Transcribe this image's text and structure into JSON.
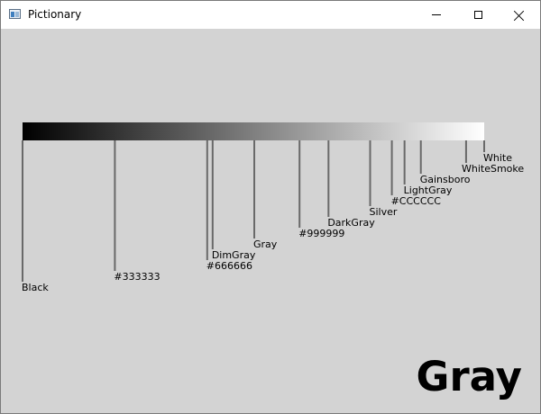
{
  "window": {
    "title": "Pictionary",
    "minimize_glyph": "—",
    "maximize_glyph": "☐",
    "close_glyph": "✕"
  },
  "gradient": {
    "start_color": "#000000",
    "end_color": "#FFFFFF"
  },
  "markers": [
    {
      "label": "Black",
      "value": 0
    },
    {
      "label": "#333333",
      "value": 51
    },
    {
      "label": "#666666",
      "value": 102
    },
    {
      "label": "DimGray",
      "value": 105
    },
    {
      "label": "Gray",
      "value": 128
    },
    {
      "label": "#999999",
      "value": 153
    },
    {
      "label": "DarkGray",
      "value": 169
    },
    {
      "label": "Silver",
      "value": 192
    },
    {
      "label": "#CCCCCC",
      "value": 204
    },
    {
      "label": "LightGray",
      "value": 211
    },
    {
      "label": "Gainsboro",
      "value": 220
    },
    {
      "label": "WhiteSmoke",
      "value": 245
    },
    {
      "label": "White",
      "value": 255
    }
  ],
  "selected_color_name": "Gray",
  "colors": {
    "background": "#D3D3D3",
    "marker_line": "#696969",
    "text": "#000000"
  }
}
